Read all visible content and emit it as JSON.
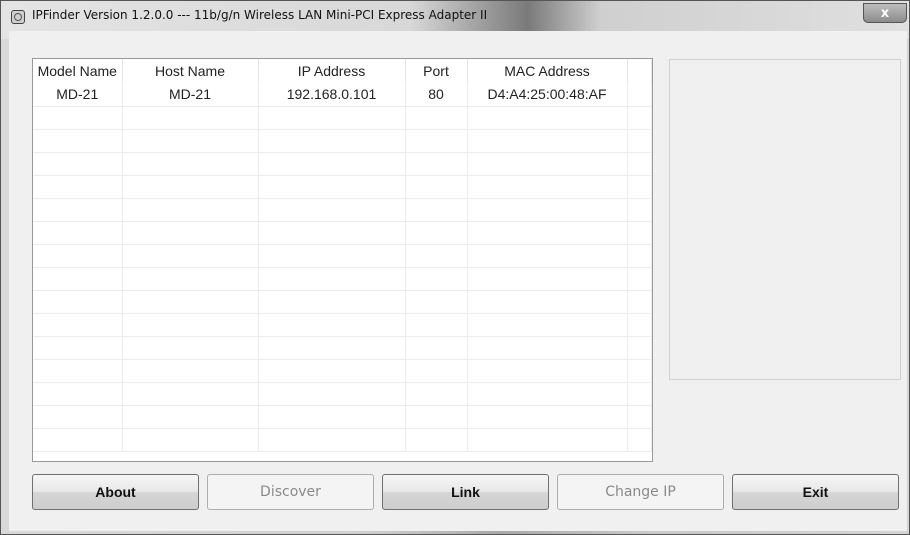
{
  "window": {
    "title": "IPFinder Version 1.2.0.0 --- 11b/g/n  Wireless LAN Mini-PCI Express Adapter II",
    "close_label": "x"
  },
  "device_list": {
    "columns": [
      "Model Name",
      "Host Name",
      "IP Address",
      "Port",
      "MAC Address"
    ],
    "rows": [
      [
        "MD-21",
        "MD-21",
        "192.168.0.101",
        "80",
        "D4:A4:25:00:48:AF"
      ]
    ],
    "empty_rows": 15
  },
  "buttons": {
    "about": "About",
    "discover": "Discover",
    "link": "Link",
    "change_ip": "Change IP",
    "exit": "Exit"
  }
}
